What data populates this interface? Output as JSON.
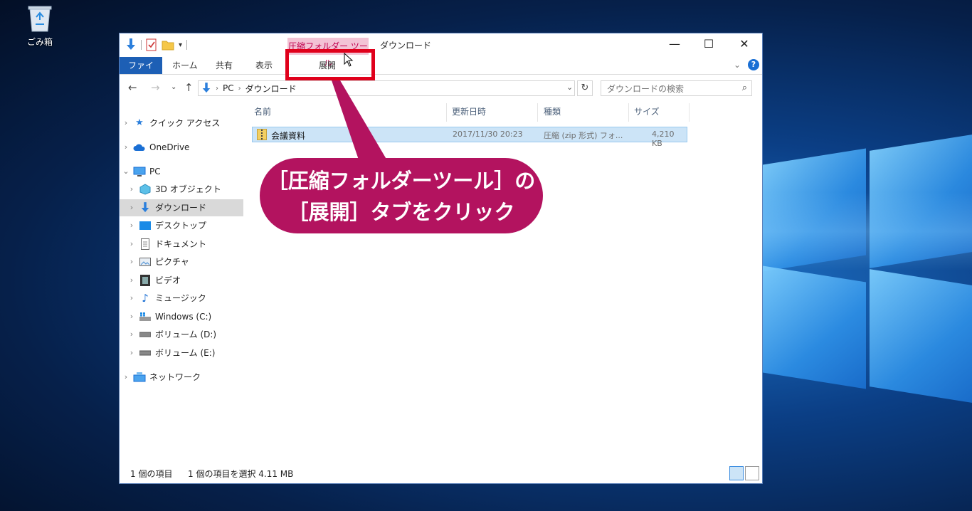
{
  "desktop": {
    "recycle_bin_label": "ごみ箱"
  },
  "window": {
    "contextual_tab": "圧縮フォルダー ツール",
    "title": "ダウンロード",
    "controls": {
      "minimize": "—",
      "maximize": "☐",
      "close": "✕"
    }
  },
  "ribbon": {
    "tabs": [
      "ファイル",
      "ホーム",
      "共有",
      "表示",
      "展開"
    ]
  },
  "address": {
    "crumbs": [
      "PC",
      "ダウンロード"
    ],
    "search_placeholder": "ダウンロードの検索"
  },
  "nav": {
    "items": [
      {
        "label": "クイック アクセス",
        "icon": "star-icon"
      },
      {
        "label": "OneDrive",
        "icon": "cloud-icon"
      },
      {
        "label": "PC",
        "icon": "computer-icon"
      },
      {
        "label": "3D オブジェクト",
        "icon": "cube-icon"
      },
      {
        "label": "ダウンロード",
        "icon": "download-arrow-icon"
      },
      {
        "label": "デスクトップ",
        "icon": "desktop-icon"
      },
      {
        "label": "ドキュメント",
        "icon": "document-icon"
      },
      {
        "label": "ピクチャ",
        "icon": "picture-icon"
      },
      {
        "label": "ビデオ",
        "icon": "video-icon"
      },
      {
        "label": "ミュージック",
        "icon": "music-icon"
      },
      {
        "label": "Windows (C:)",
        "icon": "drive-icon"
      },
      {
        "label": "ボリューム (D:)",
        "icon": "drive-icon"
      },
      {
        "label": "ボリューム (E:)",
        "icon": "drive-icon"
      },
      {
        "label": "ネットワーク",
        "icon": "network-icon"
      }
    ]
  },
  "columns": {
    "name": "名前",
    "date": "更新日時",
    "type": "種類",
    "size": "サイズ"
  },
  "files": [
    {
      "name": "会議資料",
      "date": "2017/11/30 20:23",
      "type": "圧縮 (zip 形式) フォ...",
      "size": "4,210 KB"
    }
  ],
  "status": {
    "count": "1 個の項目",
    "selected": "1 個の項目を選択  4.11 MB"
  },
  "callout": {
    "line1": "［圧縮フォルダーツール］の",
    "line2": "［展開］タブをクリック"
  },
  "colors": {
    "accent": "#1d5fb5",
    "callout": "#b3135f",
    "highlight": "#e0001b",
    "contextual": "#f3c3d5"
  }
}
